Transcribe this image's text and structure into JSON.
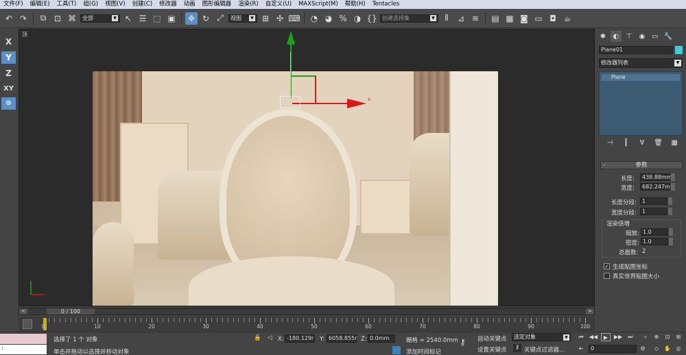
{
  "menu": [
    "文件(F)",
    "编辑(E)",
    "工具(T)",
    "组(G)",
    "视图(V)",
    "创建(C)",
    "修改器",
    "动画",
    "图形编辑器",
    "渲染(R)",
    "自定义(U)",
    "MAXScript(M)",
    "帮助(H)",
    "Tentacles"
  ],
  "toolbar": {
    "filter_value": "全部",
    "refcoord_value": "视图",
    "named_selection_placeholder": "创建选择集"
  },
  "axes": [
    "X",
    "Y",
    "Z",
    "XY"
  ],
  "viewport": {
    "label": "顶",
    "gizmo_x": "x",
    "gizmo_y": "y"
  },
  "timeslider": {
    "label": "0 / 100",
    "left": "<",
    "right": ">"
  },
  "track": {
    "ticks": [
      "0",
      "10",
      "20",
      "30",
      "40",
      "50",
      "60",
      "70",
      "80",
      "90",
      "100"
    ]
  },
  "status": {
    "selection": "选择了 1 个 对象",
    "prompt": "单击并拖动以选择并移动对象",
    "maxscript_prompt": ":",
    "x_label": "X:",
    "x_value": "-180.129r",
    "y_label": "Y:",
    "y_value": "6058.855r",
    "z_label": "Z:",
    "z_value": "0.0mm",
    "grid": "栅格 = 2540.0mm",
    "add_time_tag": "添加时间标记"
  },
  "anim": {
    "auto_key": "自动关键点",
    "set_key": "设置关键点",
    "key_mode_value": "选定对象",
    "key_filters": "关键点过滤器...",
    "frame_value": "0"
  },
  "cmd": {
    "object_name": "Plane01",
    "object_color": "#4bc6d8",
    "modifier_list": "修改器列表",
    "stack_item": "Plane",
    "params_title": "参数",
    "length_label": "长度:",
    "length_value": "438.88mm",
    "width_label": "宽度:",
    "width_value": "682.247m",
    "length_segs_label": "长度分段:",
    "length_segs_value": "1",
    "width_segs_label": "宽度分段:",
    "width_segs_value": "1",
    "render_mult_title": "渲染倍增",
    "scale_label": "缩放:",
    "scale_value": "1.0",
    "density_label": "密度:",
    "density_value": "1.0",
    "total_faces_label": "总面数:",
    "total_faces_value": "2",
    "gen_mapping_label": "生成贴图坐标",
    "real_world_label": "真实世界贴图大小",
    "gen_mapping_checked": true,
    "real_world_checked": false
  },
  "colors": {
    "accent": "#5a8fc8",
    "gizmo_x": "#d81919",
    "gizmo_y": "#1aa31a",
    "gizmo_highlight": "#ffd800"
  }
}
